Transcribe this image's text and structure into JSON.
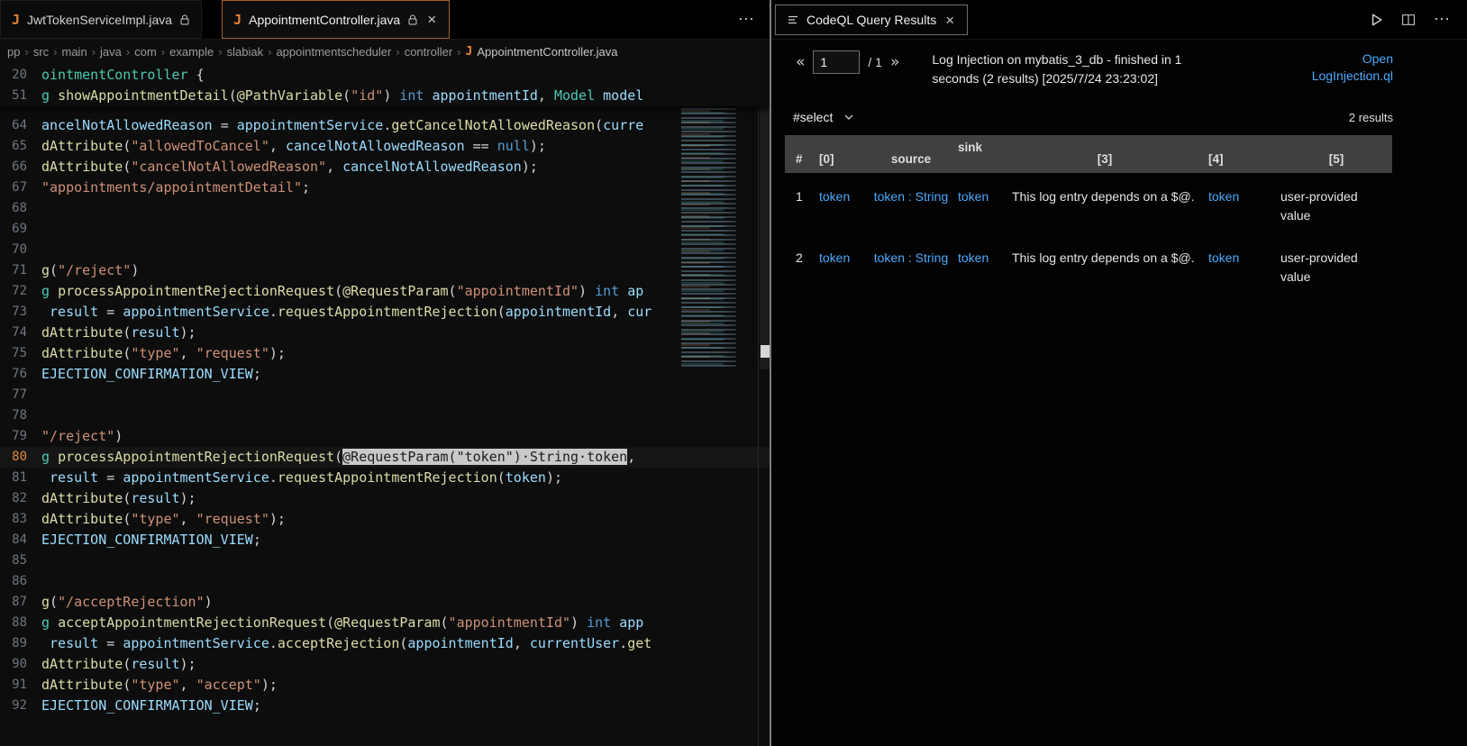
{
  "colors": {
    "accent_link": "#4daafc",
    "java_icon": "#e8833a",
    "active_tab_border": "#a85f25",
    "selection_bg": "#c9c9c9",
    "keyword": "#569cd6",
    "string": "#ce9178",
    "function": "#dcdcaa",
    "variable": "#9cdcfe",
    "class": "#4ec9b4",
    "current_line_number": "#e08a3c"
  },
  "icons": {
    "java_glyph": "J",
    "close_glyph": "×",
    "more_glyph": "⋯",
    "breadcrumb_sep": "›",
    "prev_glyph": "«",
    "next_glyph": "»"
  },
  "tabs": {
    "left": [
      {
        "label": "JwtTokenServiceImpl.java",
        "locked": true,
        "active": false
      },
      {
        "label": "AppointmentController.java",
        "locked": true,
        "active": true
      }
    ],
    "right": [
      {
        "label": "CodeQL Query Results",
        "active": true
      }
    ]
  },
  "breadcrumb": {
    "items": [
      "pp",
      "src",
      "main",
      "java",
      "com",
      "example",
      "slabiak",
      "appointmentscheduler",
      "controller"
    ],
    "file": "AppointmentController.java"
  },
  "editor": {
    "sticky_lines": [
      {
        "num": "20",
        "tokens": [
          {
            "t": "ointmentController ",
            "c": "cls"
          },
          {
            "t": "{",
            "c": "txt"
          }
        ]
      },
      {
        "num": "51",
        "tokens": [
          {
            "t": "g ",
            "c": "cls"
          },
          {
            "t": "showAppointmentDetail",
            "c": "fn"
          },
          {
            "t": "(",
            "c": "txt"
          },
          {
            "t": "@PathVariable",
            "c": "fn"
          },
          {
            "t": "(",
            "c": "txt"
          },
          {
            "t": "\"id\"",
            "c": "str"
          },
          {
            "t": ") ",
            "c": "txt"
          },
          {
            "t": "int",
            "c": "kw"
          },
          {
            "t": " appointmentId",
            "c": "var"
          },
          {
            "t": ", ",
            "c": "txt"
          },
          {
            "t": "Model",
            "c": "cls"
          },
          {
            "t": " model",
            "c": "var"
          }
        ]
      }
    ],
    "lines": [
      {
        "num": "64",
        "tokens": [
          {
            "t": "ancelNotAllowedReason ",
            "c": "var"
          },
          {
            "t": "= ",
            "c": "txt"
          },
          {
            "t": "appointmentService",
            "c": "var"
          },
          {
            "t": ".",
            "c": "txt"
          },
          {
            "t": "getCancelNotAllowedReason",
            "c": "fn"
          },
          {
            "t": "(",
            "c": "txt"
          },
          {
            "t": "curre",
            "c": "var"
          }
        ]
      },
      {
        "num": "65",
        "tokens": [
          {
            "t": "dAttribute",
            "c": "fn"
          },
          {
            "t": "(",
            "c": "txt"
          },
          {
            "t": "\"allowedToCancel\"",
            "c": "str"
          },
          {
            "t": ", ",
            "c": "txt"
          },
          {
            "t": "cancelNotAllowedReason ",
            "c": "var"
          },
          {
            "t": "== ",
            "c": "txt"
          },
          {
            "t": "null",
            "c": "kw"
          },
          {
            "t": ");",
            "c": "txt"
          }
        ]
      },
      {
        "num": "66",
        "tokens": [
          {
            "t": "dAttribute",
            "c": "fn"
          },
          {
            "t": "(",
            "c": "txt"
          },
          {
            "t": "\"cancelNotAllowedReason\"",
            "c": "str"
          },
          {
            "t": ", ",
            "c": "txt"
          },
          {
            "t": "cancelNotAllowedReason",
            "c": "var"
          },
          {
            "t": ");",
            "c": "txt"
          }
        ]
      },
      {
        "num": "67",
        "tokens": [
          {
            "t": "\"appointments/appointmentDetail\"",
            "c": "str"
          },
          {
            "t": ";",
            "c": "txt"
          }
        ]
      },
      {
        "num": "68",
        "tokens": []
      },
      {
        "num": "69",
        "tokens": []
      },
      {
        "num": "70",
        "tokens": []
      },
      {
        "num": "71",
        "tokens": [
          {
            "t": "g",
            "c": "fn"
          },
          {
            "t": "(",
            "c": "txt"
          },
          {
            "t": "\"/reject\"",
            "c": "str"
          },
          {
            "t": ")",
            "c": "txt"
          }
        ]
      },
      {
        "num": "72",
        "tokens": [
          {
            "t": "g ",
            "c": "cls"
          },
          {
            "t": "processAppointmentRejectionRequest",
            "c": "fn"
          },
          {
            "t": "(",
            "c": "txt"
          },
          {
            "t": "@RequestParam",
            "c": "fn"
          },
          {
            "t": "(",
            "c": "txt"
          },
          {
            "t": "\"appointmentId\"",
            "c": "str"
          },
          {
            "t": ") ",
            "c": "txt"
          },
          {
            "t": "int",
            "c": "kw"
          },
          {
            "t": " ap",
            "c": "var"
          }
        ]
      },
      {
        "num": "73",
        "tokens": [
          {
            "t": " result ",
            "c": "var"
          },
          {
            "t": "= ",
            "c": "txt"
          },
          {
            "t": "appointmentService",
            "c": "var"
          },
          {
            "t": ".",
            "c": "txt"
          },
          {
            "t": "requestAppointmentRejection",
            "c": "fn"
          },
          {
            "t": "(",
            "c": "txt"
          },
          {
            "t": "appointmentId",
            "c": "var"
          },
          {
            "t": ", ",
            "c": "txt"
          },
          {
            "t": "cur",
            "c": "var"
          }
        ]
      },
      {
        "num": "74",
        "tokens": [
          {
            "t": "dAttribute",
            "c": "fn"
          },
          {
            "t": "(",
            "c": "txt"
          },
          {
            "t": "result",
            "c": "var"
          },
          {
            "t": ");",
            "c": "txt"
          }
        ]
      },
      {
        "num": "75",
        "tokens": [
          {
            "t": "dAttribute",
            "c": "fn"
          },
          {
            "t": "(",
            "c": "txt"
          },
          {
            "t": "\"type\"",
            "c": "str"
          },
          {
            "t": ", ",
            "c": "txt"
          },
          {
            "t": "\"request\"",
            "c": "str"
          },
          {
            "t": ");",
            "c": "txt"
          }
        ]
      },
      {
        "num": "76",
        "tokens": [
          {
            "t": "EJECTION_CONFIRMATION_VIEW",
            "c": "var"
          },
          {
            "t": ";",
            "c": "txt"
          }
        ]
      },
      {
        "num": "77",
        "tokens": []
      },
      {
        "num": "78",
        "tokens": []
      },
      {
        "num": "79",
        "tokens": [
          {
            "t": "\"/reject\"",
            "c": "str"
          },
          {
            "t": ")",
            "c": "txt"
          }
        ]
      },
      {
        "num": "80",
        "current": true,
        "tokens": [
          {
            "t": "g ",
            "c": "cls"
          },
          {
            "t": "processAppointmentRejectionRequest",
            "c": "fn"
          },
          {
            "t": "(",
            "c": "txt"
          },
          {
            "t": "@RequestParam(\"token\")·String·token",
            "c": "sel"
          },
          {
            "t": ",",
            "c": "txt"
          }
        ]
      },
      {
        "num": "81",
        "tokens": [
          {
            "t": " result ",
            "c": "var"
          },
          {
            "t": "= ",
            "c": "txt"
          },
          {
            "t": "appointmentService",
            "c": "var"
          },
          {
            "t": ".",
            "c": "txt"
          },
          {
            "t": "requestAppointmentRejection",
            "c": "fn"
          },
          {
            "t": "(",
            "c": "txt"
          },
          {
            "t": "token",
            "c": "var"
          },
          {
            "t": ");",
            "c": "txt"
          }
        ]
      },
      {
        "num": "82",
        "tokens": [
          {
            "t": "dAttribute",
            "c": "fn"
          },
          {
            "t": "(",
            "c": "txt"
          },
          {
            "t": "result",
            "c": "var"
          },
          {
            "t": ");",
            "c": "txt"
          }
        ]
      },
      {
        "num": "83",
        "tokens": [
          {
            "t": "dAttribute",
            "c": "fn"
          },
          {
            "t": "(",
            "c": "txt"
          },
          {
            "t": "\"type\"",
            "c": "str"
          },
          {
            "t": ", ",
            "c": "txt"
          },
          {
            "t": "\"request\"",
            "c": "str"
          },
          {
            "t": ");",
            "c": "txt"
          }
        ]
      },
      {
        "num": "84",
        "tokens": [
          {
            "t": "EJECTION_CONFIRMATION_VIEW",
            "c": "var"
          },
          {
            "t": ";",
            "c": "txt"
          }
        ]
      },
      {
        "num": "85",
        "tokens": []
      },
      {
        "num": "86",
        "tokens": []
      },
      {
        "num": "87",
        "tokens": [
          {
            "t": "g",
            "c": "fn"
          },
          {
            "t": "(",
            "c": "txt"
          },
          {
            "t": "\"/acceptRejection\"",
            "c": "str"
          },
          {
            "t": ")",
            "c": "txt"
          }
        ]
      },
      {
        "num": "88",
        "tokens": [
          {
            "t": "g ",
            "c": "cls"
          },
          {
            "t": "acceptAppointmentRejectionRequest",
            "c": "fn"
          },
          {
            "t": "(",
            "c": "txt"
          },
          {
            "t": "@RequestParam",
            "c": "fn"
          },
          {
            "t": "(",
            "c": "txt"
          },
          {
            "t": "\"appointmentId\"",
            "c": "str"
          },
          {
            "t": ") ",
            "c": "txt"
          },
          {
            "t": "int",
            "c": "kw"
          },
          {
            "t": " app",
            "c": "var"
          }
        ]
      },
      {
        "num": "89",
        "tokens": [
          {
            "t": " result ",
            "c": "var"
          },
          {
            "t": "= ",
            "c": "txt"
          },
          {
            "t": "appointmentService",
            "c": "var"
          },
          {
            "t": ".",
            "c": "txt"
          },
          {
            "t": "acceptRejection",
            "c": "fn"
          },
          {
            "t": "(",
            "c": "txt"
          },
          {
            "t": "appointmentId",
            "c": "var"
          },
          {
            "t": ", ",
            "c": "txt"
          },
          {
            "t": "currentUser",
            "c": "var"
          },
          {
            "t": ".",
            "c": "txt"
          },
          {
            "t": "get",
            "c": "fn"
          }
        ]
      },
      {
        "num": "90",
        "tokens": [
          {
            "t": "dAttribute",
            "c": "fn"
          },
          {
            "t": "(",
            "c": "txt"
          },
          {
            "t": "result",
            "c": "var"
          },
          {
            "t": ");",
            "c": "txt"
          }
        ]
      },
      {
        "num": "91",
        "tokens": [
          {
            "t": "dAttribute",
            "c": "fn"
          },
          {
            "t": "(",
            "c": "txt"
          },
          {
            "t": "\"type\"",
            "c": "str"
          },
          {
            "t": ", ",
            "c": "txt"
          },
          {
            "t": "\"accept\"",
            "c": "str"
          },
          {
            "t": ");",
            "c": "txt"
          }
        ]
      },
      {
        "num": "92",
        "tokens": [
          {
            "t": "EJECTION_CONFIRMATION_VIEW",
            "c": "var"
          },
          {
            "t": ";",
            "c": "txt"
          }
        ]
      }
    ]
  },
  "results_panel": {
    "pagination": {
      "prev": "«",
      "page": "1",
      "total_label": "/ 1",
      "next": "»"
    },
    "status": "Log Injection on mybatis_3_db - finished in 1 seconds (2 results) [2025/7/24 23:23:02]",
    "open_link": "Open LogInjection.ql",
    "select_label": "#select",
    "results_count": "2 results",
    "table": {
      "headers": [
        "#",
        "[0]",
        "source",
        "sink",
        "[3]",
        "[4]",
        "[5]"
      ],
      "rows": [
        {
          "num": "1",
          "cells": [
            {
              "t": "token",
              "link": true
            },
            {
              "t": "token : String",
              "link": true
            },
            {
              "t": "token",
              "link": true
            },
            {
              "t": "This log entry depends on a $@.",
              "link": false
            },
            {
              "t": "token",
              "link": true
            },
            {
              "t": "user-provided value",
              "link": false
            }
          ]
        },
        {
          "num": "2",
          "cells": [
            {
              "t": "token",
              "link": true
            },
            {
              "t": "token : String",
              "link": true
            },
            {
              "t": "token",
              "link": true
            },
            {
              "t": "This log entry depends on a $@.",
              "link": false
            },
            {
              "t": "token",
              "link": true
            },
            {
              "t": "user-provided value",
              "link": false
            }
          ]
        }
      ]
    }
  }
}
